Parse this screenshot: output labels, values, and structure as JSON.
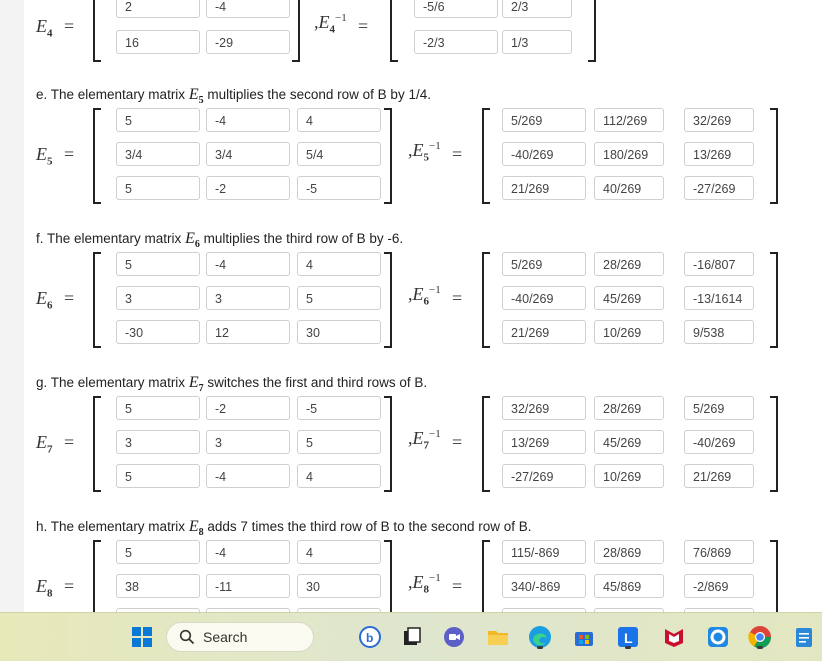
{
  "sections": [
    {
      "id": "d",
      "prompt": null,
      "matrix_label": "E",
      "matrix_sub": "4",
      "matrix": [
        [
          "2",
          "-4"
        ],
        [
          "16",
          "-29"
        ]
      ],
      "inverse": [
        [
          "-5/6",
          "2/3"
        ],
        [
          "-2/3",
          "1/3"
        ]
      ]
    },
    {
      "id": "e",
      "prompt": {
        "pre": "e. The elementary matrix ",
        "sub": "5",
        "post": " multiplies the second row of B by 1/4."
      },
      "matrix_sub": "5",
      "matrix": [
        [
          "5",
          "-4",
          "4"
        ],
        [
          "3/4",
          "3/4",
          "5/4"
        ],
        [
          "5",
          "-2",
          "-5"
        ]
      ],
      "inverse": [
        [
          "5/269",
          "112/269",
          "32/269"
        ],
        [
          "-40/269",
          "180/269",
          "13/269"
        ],
        [
          "21/269",
          "40/269",
          "-27/269"
        ]
      ]
    },
    {
      "id": "f",
      "prompt": {
        "pre": "f. The elementary matrix ",
        "sub": "6",
        "post": " multiplies the third row of B by -6."
      },
      "matrix_sub": "6",
      "matrix": [
        [
          "5",
          "-4",
          "4"
        ],
        [
          "3",
          "3",
          "5"
        ],
        [
          "-30",
          "12",
          "30"
        ]
      ],
      "inverse": [
        [
          "5/269",
          "28/269",
          "-16/807"
        ],
        [
          "-40/269",
          "45/269",
          "-13/1614"
        ],
        [
          "21/269",
          "10/269",
          "9/538"
        ]
      ]
    },
    {
      "id": "g",
      "prompt": {
        "pre": "g. The elementary matrix ",
        "sub": "7",
        "post": " switches the first and third rows of B."
      },
      "matrix_sub": "7",
      "matrix": [
        [
          "5",
          "-2",
          "-5"
        ],
        [
          "3",
          "3",
          "5"
        ],
        [
          "5",
          "-4",
          "4"
        ]
      ],
      "inverse": [
        [
          "32/269",
          "28/269",
          "5/269"
        ],
        [
          "13/269",
          "45/269",
          "-40/269"
        ],
        [
          "-27/269",
          "10/269",
          "21/269"
        ]
      ]
    },
    {
      "id": "h",
      "prompt": {
        "pre": "h. The elementary matrix ",
        "sub": "8",
        "post": " adds 7 times the third row of B to the second row of B."
      },
      "matrix_sub": "8",
      "matrix": [
        [
          "5",
          "-4",
          "4"
        ],
        [
          "38",
          "-11",
          "30"
        ],
        [
          "",
          "",
          ""
        ]
      ],
      "inverse": [
        [
          "115/-869",
          "28/869",
          "76/869"
        ],
        [
          "340/-869",
          "45/869",
          "-2/869"
        ],
        [
          "",
          "",
          ""
        ]
      ]
    }
  ],
  "symbols": {
    "E": "E",
    "eq": "=",
    "inv_sup": "−1",
    "comma": ","
  },
  "taskbar": {
    "search_placeholder": "Search",
    "icons": [
      "windows-start-icon",
      "search-icon",
      "bing-icon",
      "file-explorer-icon",
      "meet-icon",
      "folder-icon",
      "edge-icon",
      "store-icon",
      "l-app-icon",
      "mcafee-icon",
      "circle-app-icon",
      "chrome-icon",
      "notepad-icon"
    ],
    "colors": {
      "accent": "#0078d4",
      "background": "#e3e7c1"
    }
  }
}
